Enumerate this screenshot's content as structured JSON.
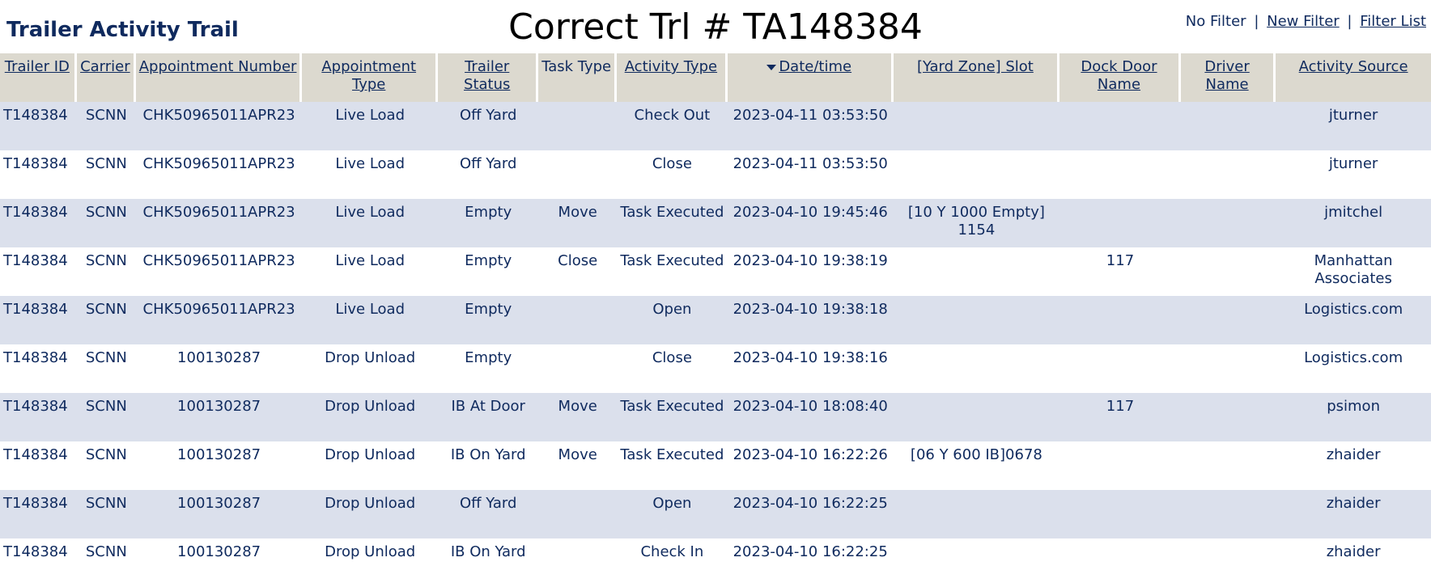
{
  "header": {
    "app_title": "Trailer Activity Trail",
    "page_title": "Correct Trl # TA148384",
    "filter_status": "No Filter",
    "new_filter": "New Filter",
    "filter_list": "Filter List",
    "separator": "|"
  },
  "table": {
    "columns": [
      {
        "label": "Trailer ID",
        "sortable": true
      },
      {
        "label": "Carrier",
        "sortable": true
      },
      {
        "label": "Appointment Number",
        "sortable": true
      },
      {
        "label": "Appointment Type",
        "sortable": true
      },
      {
        "label": "Trailer Status",
        "sortable": true
      },
      {
        "label": "Task Type",
        "sortable": false
      },
      {
        "label": "Activity Type",
        "sortable": true
      },
      {
        "label": "Date/time",
        "sortable": true,
        "sorted": "desc"
      },
      {
        "label": "[Yard Zone] Slot",
        "sortable": true
      },
      {
        "label": "Dock Door Name",
        "sortable": true
      },
      {
        "label": "Driver Name",
        "sortable": true
      },
      {
        "label": "Activity Source",
        "sortable": true
      }
    ],
    "rows": [
      [
        "T148384",
        "SCNN",
        "CHK50965011APR23",
        "Live Load",
        "Off Yard",
        "",
        "Check Out",
        "2023-04-11 03:53:50",
        "",
        "",
        "",
        "jturner"
      ],
      [
        "T148384",
        "SCNN",
        "CHK50965011APR23",
        "Live Load",
        "Off Yard",
        "",
        "Close",
        "2023-04-11 03:53:50",
        "",
        "",
        "",
        "jturner"
      ],
      [
        "T148384",
        "SCNN",
        "CHK50965011APR23",
        "Live Load",
        "Empty",
        "Move",
        "Task Executed",
        "2023-04-10 19:45:46",
        "[10 Y 1000 Empty] 1154",
        "",
        "",
        "jmitchel"
      ],
      [
        "T148384",
        "SCNN",
        "CHK50965011APR23",
        "Live Load",
        "Empty",
        "Close",
        "Task Executed",
        "2023-04-10 19:38:19",
        "",
        "117",
        "",
        "Manhattan Associates"
      ],
      [
        "T148384",
        "SCNN",
        "CHK50965011APR23",
        "Live Load",
        "Empty",
        "",
        "Open",
        "2023-04-10 19:38:18",
        "",
        "",
        "",
        "Logistics.com"
      ],
      [
        "T148384",
        "SCNN",
        "100130287",
        "Drop Unload",
        "Empty",
        "",
        "Close",
        "2023-04-10 19:38:16",
        "",
        "",
        "",
        "Logistics.com"
      ],
      [
        "T148384",
        "SCNN",
        "100130287",
        "Drop Unload",
        "IB At Door",
        "Move",
        "Task Executed",
        "2023-04-10 18:08:40",
        "",
        "117",
        "",
        "psimon"
      ],
      [
        "T148384",
        "SCNN",
        "100130287",
        "Drop Unload",
        "IB On Yard",
        "Move",
        "Task Executed",
        "2023-04-10 16:22:26",
        "[06 Y 600 IB]0678",
        "",
        "",
        "zhaider"
      ],
      [
        "T148384",
        "SCNN",
        "100130287",
        "Drop Unload",
        "Off Yard",
        "",
        "Open",
        "2023-04-10 16:22:25",
        "",
        "",
        "",
        "zhaider"
      ],
      [
        "T148384",
        "SCNN",
        "100130287",
        "Drop Unload",
        "IB On Yard",
        "",
        "Check In",
        "2023-04-10 16:22:25",
        "",
        "",
        "",
        "zhaider"
      ]
    ]
  },
  "colors": {
    "header_bg": "#dcd9cf",
    "row_alt": "#dbe0ec",
    "text": "#0f2a5e"
  }
}
